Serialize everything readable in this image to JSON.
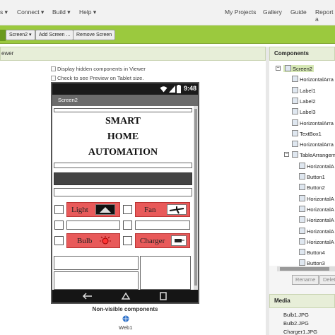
{
  "topnav": {
    "left": [
      "s ▾",
      "Connect ▾",
      "Build ▾",
      "Help ▾"
    ],
    "right": [
      "My Projects",
      "Gallery",
      "Guide",
      "Report a"
    ]
  },
  "toolbar": {
    "screen_select": "Screen2 ▾",
    "add_screen": "Add Screen ...",
    "remove_screen": "Remove Screen"
  },
  "viewer": {
    "header": "ewer",
    "display_hidden": "Display hidden components in Viewer",
    "tablet_preview": "Check to see Preview on Tablet size."
  },
  "phone": {
    "time": "9:48",
    "screen_title": "Screen2",
    "title_lines": [
      "SMART",
      "HOME",
      "AUTOMATION"
    ],
    "buttons": {
      "light": "Light",
      "fan": "Fan",
      "bulb": "Bulb",
      "charger": "Charger"
    },
    "nonvisible_label": "Non-visible components",
    "web_component": "Web1"
  },
  "components": {
    "header": "Components",
    "items": [
      {
        "label": "Screen2",
        "level": 0,
        "selected": true
      },
      {
        "label": "HorizontalArra",
        "level": 1
      },
      {
        "label": "Label1",
        "level": 1
      },
      {
        "label": "Label2",
        "level": 1
      },
      {
        "label": "Label3",
        "level": 1
      },
      {
        "label": "HorizontalArra",
        "level": 1
      },
      {
        "label": "TextBox1",
        "level": 1
      },
      {
        "label": "HorizontalArra",
        "level": 1
      },
      {
        "label": "TableArrangem",
        "level": 1
      },
      {
        "label": "HorizontalA",
        "level": 2
      },
      {
        "label": "Button1",
        "level": 2
      },
      {
        "label": "Button2",
        "level": 2
      },
      {
        "label": "HorizontalA",
        "level": 2
      },
      {
        "label": "HorizontalA",
        "level": 2
      },
      {
        "label": "HorizontalA",
        "level": 2
      },
      {
        "label": "HorizontalA",
        "level": 2
      },
      {
        "label": "HorizontalA",
        "level": 2
      },
      {
        "label": "Button4",
        "level": 2
      },
      {
        "label": "Button3",
        "level": 2
      }
    ],
    "rename": "Rename",
    "delete": "Delet"
  },
  "media": {
    "header": "Media",
    "files": [
      "Bulb1.JPG",
      "Bulb2.JPG",
      "Charger1.JPG"
    ]
  }
}
